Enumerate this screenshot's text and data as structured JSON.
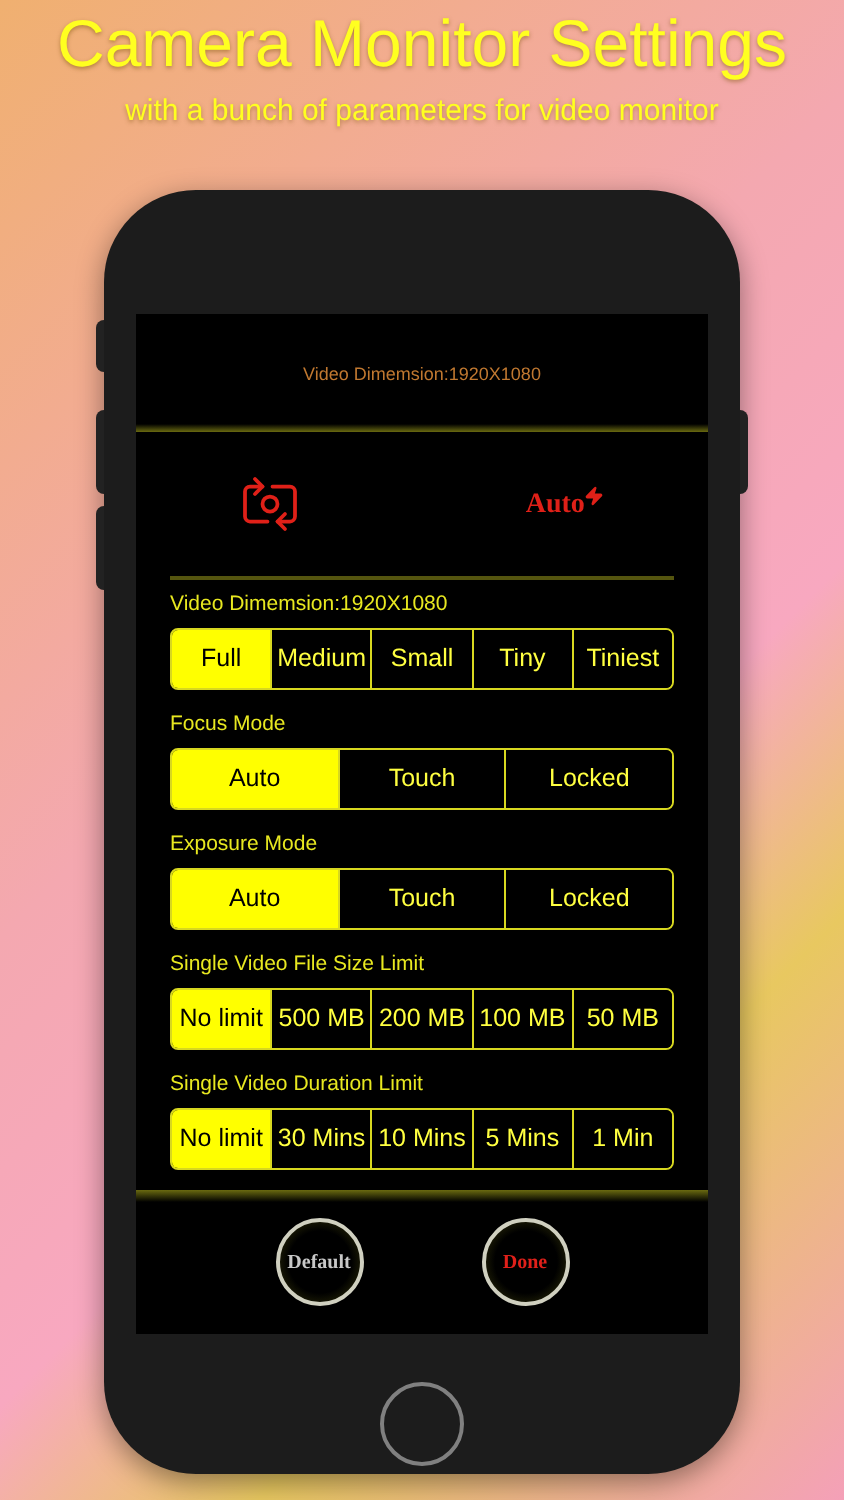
{
  "title": "Camera Monitor Settings",
  "subtitle": "with a bunch of parameters for video monitor",
  "screen": {
    "header": "Video Dimemsion:1920X1080",
    "flash_label": "Auto",
    "sections": [
      {
        "label": "Video Dimemsion:1920X1080",
        "options": [
          {
            "label": "Full",
            "selected": true
          },
          {
            "label": "Medium",
            "selected": false
          },
          {
            "label": "Small",
            "selected": false
          },
          {
            "label": "Tiny",
            "selected": false
          },
          {
            "label": "Tiniest",
            "selected": false
          }
        ]
      },
      {
        "label": "Focus Mode",
        "options": [
          {
            "label": "Auto",
            "selected": true
          },
          {
            "label": "Touch",
            "selected": false
          },
          {
            "label": "Locked",
            "selected": false
          }
        ]
      },
      {
        "label": "Exposure Mode",
        "options": [
          {
            "label": "Auto",
            "selected": true
          },
          {
            "label": "Touch",
            "selected": false
          },
          {
            "label": "Locked",
            "selected": false
          }
        ]
      },
      {
        "label": "Single Video File Size Limit",
        "options": [
          {
            "label": "No limit",
            "selected": true
          },
          {
            "label": "500 MB",
            "selected": false
          },
          {
            "label": "200 MB",
            "selected": false
          },
          {
            "label": "100 MB",
            "selected": false
          },
          {
            "label": "50 MB",
            "selected": false
          }
        ]
      },
      {
        "label": "Single Video Duration Limit",
        "options": [
          {
            "label": "No limit",
            "selected": true
          },
          {
            "label": "30 Mins",
            "selected": false
          },
          {
            "label": "10 Mins",
            "selected": false
          },
          {
            "label": "5 Mins",
            "selected": false
          },
          {
            "label": "1 Min",
            "selected": false
          }
        ]
      }
    ],
    "buttons": [
      {
        "label": "Default",
        "kind": "default"
      },
      {
        "label": "Done",
        "kind": "done"
      }
    ]
  }
}
